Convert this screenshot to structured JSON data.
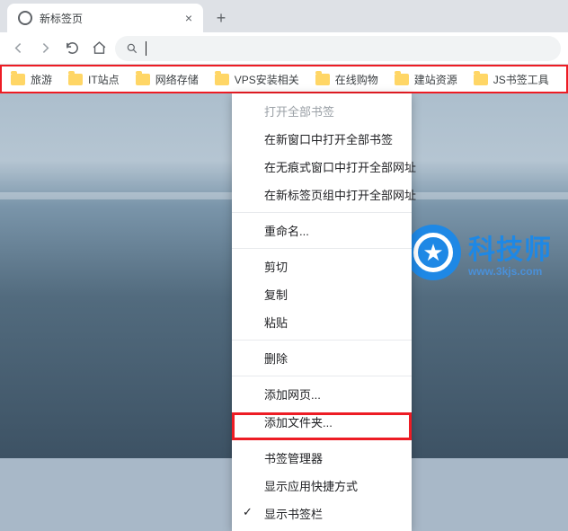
{
  "tab": {
    "title": "新标签页"
  },
  "bookmarks": [
    "旅游",
    "IT站点",
    "网络存储",
    "VPS安装相关",
    "在线购物",
    "建站资源",
    "JS书签工具"
  ],
  "menu": {
    "items": [
      {
        "label": "打开全部书签",
        "disabled": true
      },
      {
        "label": "在新窗口中打开全部书签"
      },
      {
        "label": "在无痕式窗口中打开全部网址"
      },
      {
        "label": "在新标签页组中打开全部网址"
      },
      {
        "sep": true
      },
      {
        "label": "重命名..."
      },
      {
        "sep": true
      },
      {
        "label": "剪切"
      },
      {
        "label": "复制"
      },
      {
        "label": "粘贴"
      },
      {
        "sep": true
      },
      {
        "label": "删除"
      },
      {
        "sep": true
      },
      {
        "label": "添加网页..."
      },
      {
        "label": "添加文件夹..."
      },
      {
        "sep": true
      },
      {
        "label": "书签管理器"
      },
      {
        "label": "显示应用快捷方式"
      },
      {
        "label": "显示书签栏",
        "checked": true
      }
    ]
  },
  "watermark": {
    "big": "科技师",
    "small": "www.3kjs.com"
  }
}
